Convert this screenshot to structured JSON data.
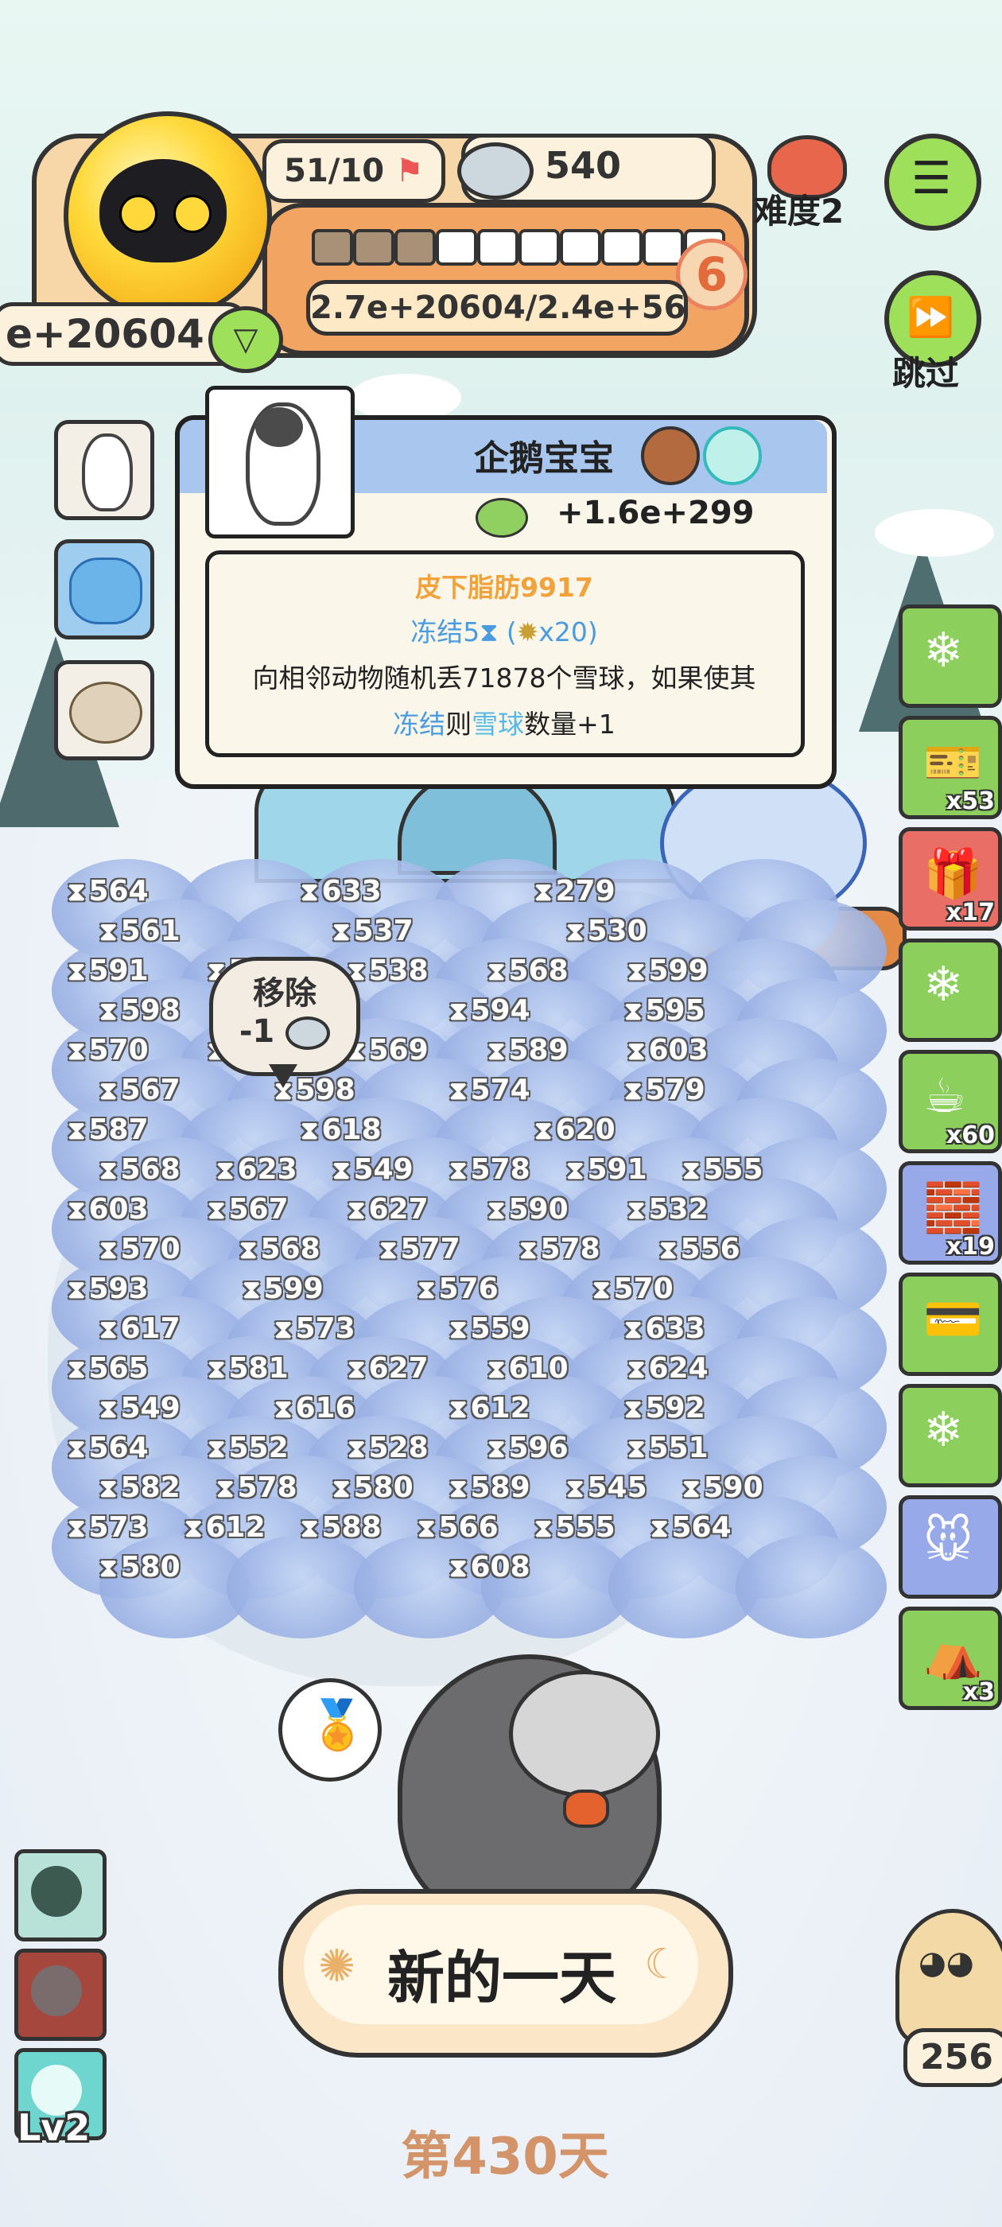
{
  "hud": {
    "flag_count": "51/10",
    "coins": "540",
    "difficulty": "难度2",
    "left_score": "e+20604",
    "progress_text": "2.7e+20604/2.4e+56",
    "level": "6",
    "progress_filled_segments": 3,
    "progress_total_segments": 10,
    "skip_label": "跳过"
  },
  "popup": {
    "title": "企鹅宝宝",
    "value": "+1.6e+299",
    "line1": "皮下脂肪9917",
    "line2_a": "冻结5",
    "line2_b": "(",
    "line2_c": "x20)",
    "line3": "向相邻动物随机丢71878个雪球，如果使其",
    "line4_a": "冻结",
    "line4_b": "则",
    "line4_c": "雪球",
    "line4_d": "数量+1",
    "colors": {
      "orange": "#f2a23a",
      "blue": "#4a9be0",
      "ice": "#58b9e6"
    }
  },
  "remove_bubble": {
    "label": "移除",
    "count": "-1"
  },
  "right_items": [
    {
      "name": "snow-globe",
      "count": ""
    },
    {
      "name": "ticket",
      "count": "x53"
    },
    {
      "name": "gift-bag",
      "count": "x17"
    },
    {
      "name": "snow-globe",
      "count": ""
    },
    {
      "name": "hot-cocoa",
      "count": "x60"
    },
    {
      "name": "fireplace",
      "count": "x19"
    },
    {
      "name": "credit-card",
      "count": ""
    },
    {
      "name": "snow-globe",
      "count": ""
    },
    {
      "name": "toy-mouse",
      "count": ""
    },
    {
      "name": "tent",
      "count": "x3"
    }
  ],
  "snow_numbers": [
    [
      "564",
      "633",
      "279"
    ],
    [
      "561",
      "537",
      "530"
    ],
    [
      "591",
      "560",
      "538",
      "568",
      "599"
    ],
    [
      "598",
      "571",
      "594",
      "595"
    ],
    [
      "570",
      "586",
      "569",
      "589",
      "603"
    ],
    [
      "567",
      "598",
      "574",
      "579"
    ],
    [
      "587",
      "618",
      "620"
    ],
    [
      "568",
      "623",
      "549",
      "578",
      "591",
      "555"
    ],
    [
      "603",
      "567",
      "627",
      "590",
      "532"
    ],
    [
      "570",
      "568",
      "577",
      "578",
      "556"
    ],
    [
      "593",
      "599",
      "576",
      "570"
    ],
    [
      "617",
      "573",
      "559",
      "633"
    ],
    [
      "565",
      "581",
      "627",
      "610",
      "624"
    ],
    [
      "549",
      "616",
      "612",
      "592"
    ],
    [
      "564",
      "552",
      "528",
      "596",
      "551"
    ],
    [
      "582",
      "578",
      "580",
      "589",
      "545",
      "590"
    ],
    [
      "573",
      "612",
      "588",
      "566",
      "555",
      "564"
    ],
    [
      "580",
      "608"
    ]
  ],
  "bottom": {
    "new_day": "新的一天",
    "day": "第430天",
    "lv": "Lv2",
    "bird_count": "256"
  }
}
